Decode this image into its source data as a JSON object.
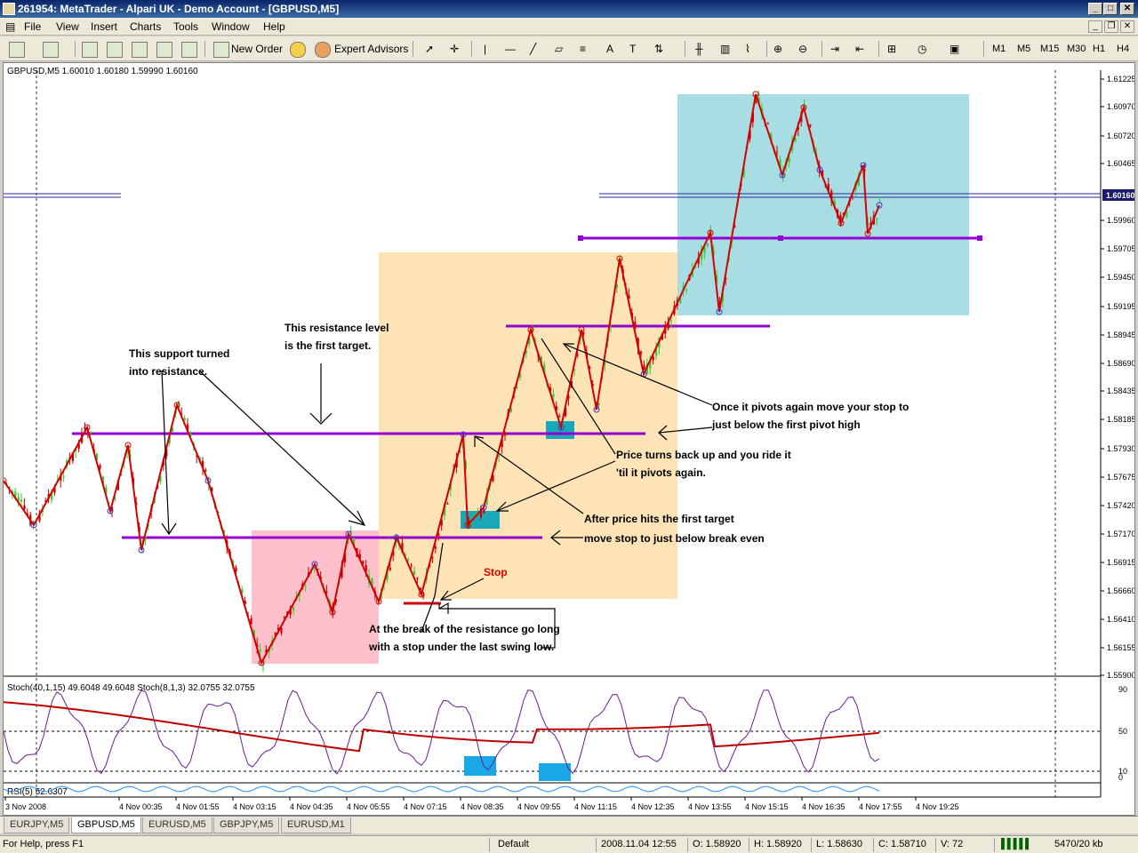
{
  "window": {
    "title": "261954: MetaTrader - Alpari UK - Demo Account - [GBPUSD,M5]"
  },
  "menu": [
    "File",
    "View",
    "Insert",
    "Charts",
    "Tools",
    "Window",
    "Help"
  ],
  "toolbar": {
    "new_order": "New Order",
    "expert_advisors": "Expert Advisors",
    "timeframes": [
      "M1",
      "M5",
      "M15",
      "M30",
      "H1",
      "H4"
    ]
  },
  "chart": {
    "header": "GBPUSD,M5  1.60010 1.60180 1.59990 1.60160",
    "current_price": "1.60160",
    "price_ticks": [
      "1.61225",
      "1.60970",
      "1.60720",
      "1.60465",
      "1.59960",
      "1.59705",
      "1.59450",
      "1.59195",
      "1.58945",
      "1.58690",
      "1.58435",
      "1.58185",
      "1.57930",
      "1.57675",
      "1.57420",
      "1.57170",
      "1.56915",
      "1.56660",
      "1.56410",
      "1.56155",
      "1.55900"
    ],
    "time_ticks": [
      "3 Nov 2008",
      "4 Nov 00:35",
      "4 Nov 01:55",
      "4 Nov 03:15",
      "4 Nov 04:35",
      "4 Nov 05:55",
      "4 Nov 07:15",
      "4 Nov 08:35",
      "4 Nov 09:55",
      "4 Nov 11:15",
      "4 Nov 12:35",
      "4 Nov 13:55",
      "4 Nov 15:15",
      "4 Nov 16:35",
      "4 Nov 17:55",
      "4 Nov 19:25"
    ],
    "stoch_header": "Stoch(40,1,15) 49.6048 49.6048 Stoch(8,1,3) 32.0755 32.0755",
    "stoch_ticks": [
      "90",
      "50",
      "10",
      "0"
    ],
    "rsi_header": "RSI(5) 52.6307",
    "annotations": {
      "support_1": "This support turned",
      "support_2": "into resistance.",
      "resist_1": "This resistance level",
      "resist_2": "is the first target.",
      "pivot_1": "Once it pivots again move your stop to",
      "pivot_2": "just below the first pivot high",
      "ride_1": "Price turns back up and you ride it",
      "ride_2": "'til it pivots again.",
      "target_1": "After price hits the first target",
      "target_2": "move stop to just below break even",
      "stop": "Stop",
      "long_1": "At the break of the resistance go long",
      "long_2": "with a stop under the last swing low."
    }
  },
  "tabs": [
    "EURJPY,M5",
    "GBPUSD,M5",
    "EURUSD,M5",
    "GBPJPY,M5",
    "EURUSD,M1"
  ],
  "status": {
    "help": "For Help, press F1",
    "profile": "Default",
    "time": "2008.11.04 12:55",
    "open": "O: 1.58920",
    "high": "H: 1.58920",
    "low": "L: 1.58630",
    "close": "C: 1.58710",
    "volume": "V: 72",
    "traffic": "5470/20 kb"
  },
  "colors": {
    "support_line": "#9400d3",
    "zigzag": "#d40000",
    "bull_candle": "#32cd32",
    "bear_candle": "#cc0000",
    "pink_zone": "#ffc0cb",
    "orange_zone": "#fde3b6",
    "blue_zone": "#a8dde3"
  }
}
